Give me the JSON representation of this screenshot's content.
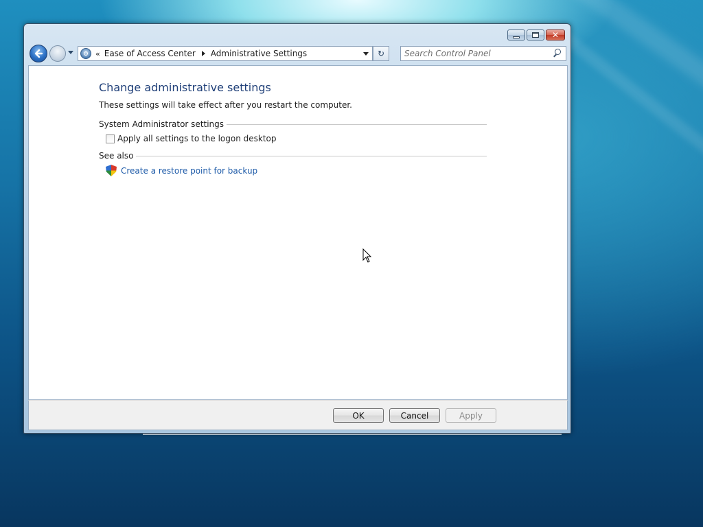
{
  "window": {
    "caption": {
      "minimize_glyph": "minimize",
      "maximize_glyph": "maximize",
      "close_glyph": "✕"
    },
    "nav": {
      "back": "back",
      "forward": "forward"
    },
    "address": {
      "overflow": "«",
      "breadcrumbs": [
        "Ease of Access Center",
        "Administrative Settings"
      ]
    },
    "refresh_glyph": "↻",
    "search": {
      "placeholder": "Search Control Panel"
    }
  },
  "page": {
    "title": "Change administrative settings",
    "description": "These settings will take effect after you restart the computer.",
    "sections": {
      "admin": {
        "heading": "System Administrator settings",
        "checkbox_label": "Apply all settings to the logon desktop",
        "checkbox_checked": false
      },
      "see_also": {
        "heading": "See also",
        "link": "Create a restore point for backup"
      }
    }
  },
  "footer": {
    "ok": "OK",
    "cancel": "Cancel",
    "apply": "Apply",
    "apply_enabled": false
  },
  "colors": {
    "title": "#1f3f78",
    "link": "#1d5aa8",
    "accent_close": "#c23a26"
  }
}
